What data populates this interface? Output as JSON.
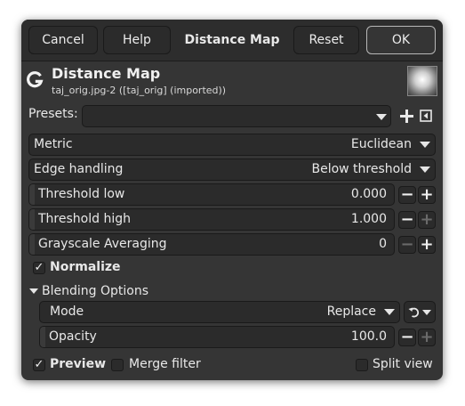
{
  "header": {
    "cancel_label": "Cancel",
    "help_label": "Help",
    "title": "Distance Map",
    "reset_label": "Reset",
    "ok_label": "OK"
  },
  "operation": {
    "title": "Distance Map",
    "subtitle": "taj_orig.jpg-2 ([taj_orig] (imported))"
  },
  "presets": {
    "label": "Presets:",
    "value": ""
  },
  "metric": {
    "label": "Metric",
    "value": "Euclidean"
  },
  "edge_handling": {
    "label": "Edge handling",
    "value": "Below threshold"
  },
  "threshold_low": {
    "label": "Threshold low",
    "value": "0.000"
  },
  "threshold_high": {
    "label": "Threshold high",
    "value": "1.000"
  },
  "grayscale_averaging": {
    "label": "Grayscale Averaging",
    "value": "0"
  },
  "normalize": {
    "label": "Normalize",
    "checked": true
  },
  "blending": {
    "label": "Blending Options",
    "mode": {
      "label": "Mode",
      "value": "Replace"
    },
    "opacity": {
      "label": "Opacity",
      "value": "100.0"
    }
  },
  "footer": {
    "preview": {
      "label": "Preview",
      "checked": true
    },
    "merge_filter": {
      "label": "Merge filter",
      "checked": false
    },
    "split_view": {
      "label": "Split view",
      "checked": false
    }
  },
  "icons": {
    "logo": "gegl-logo-icon",
    "add_preset": "plus-icon",
    "preset_menu": "menu-icon",
    "reset_mode": "switch-icon"
  }
}
